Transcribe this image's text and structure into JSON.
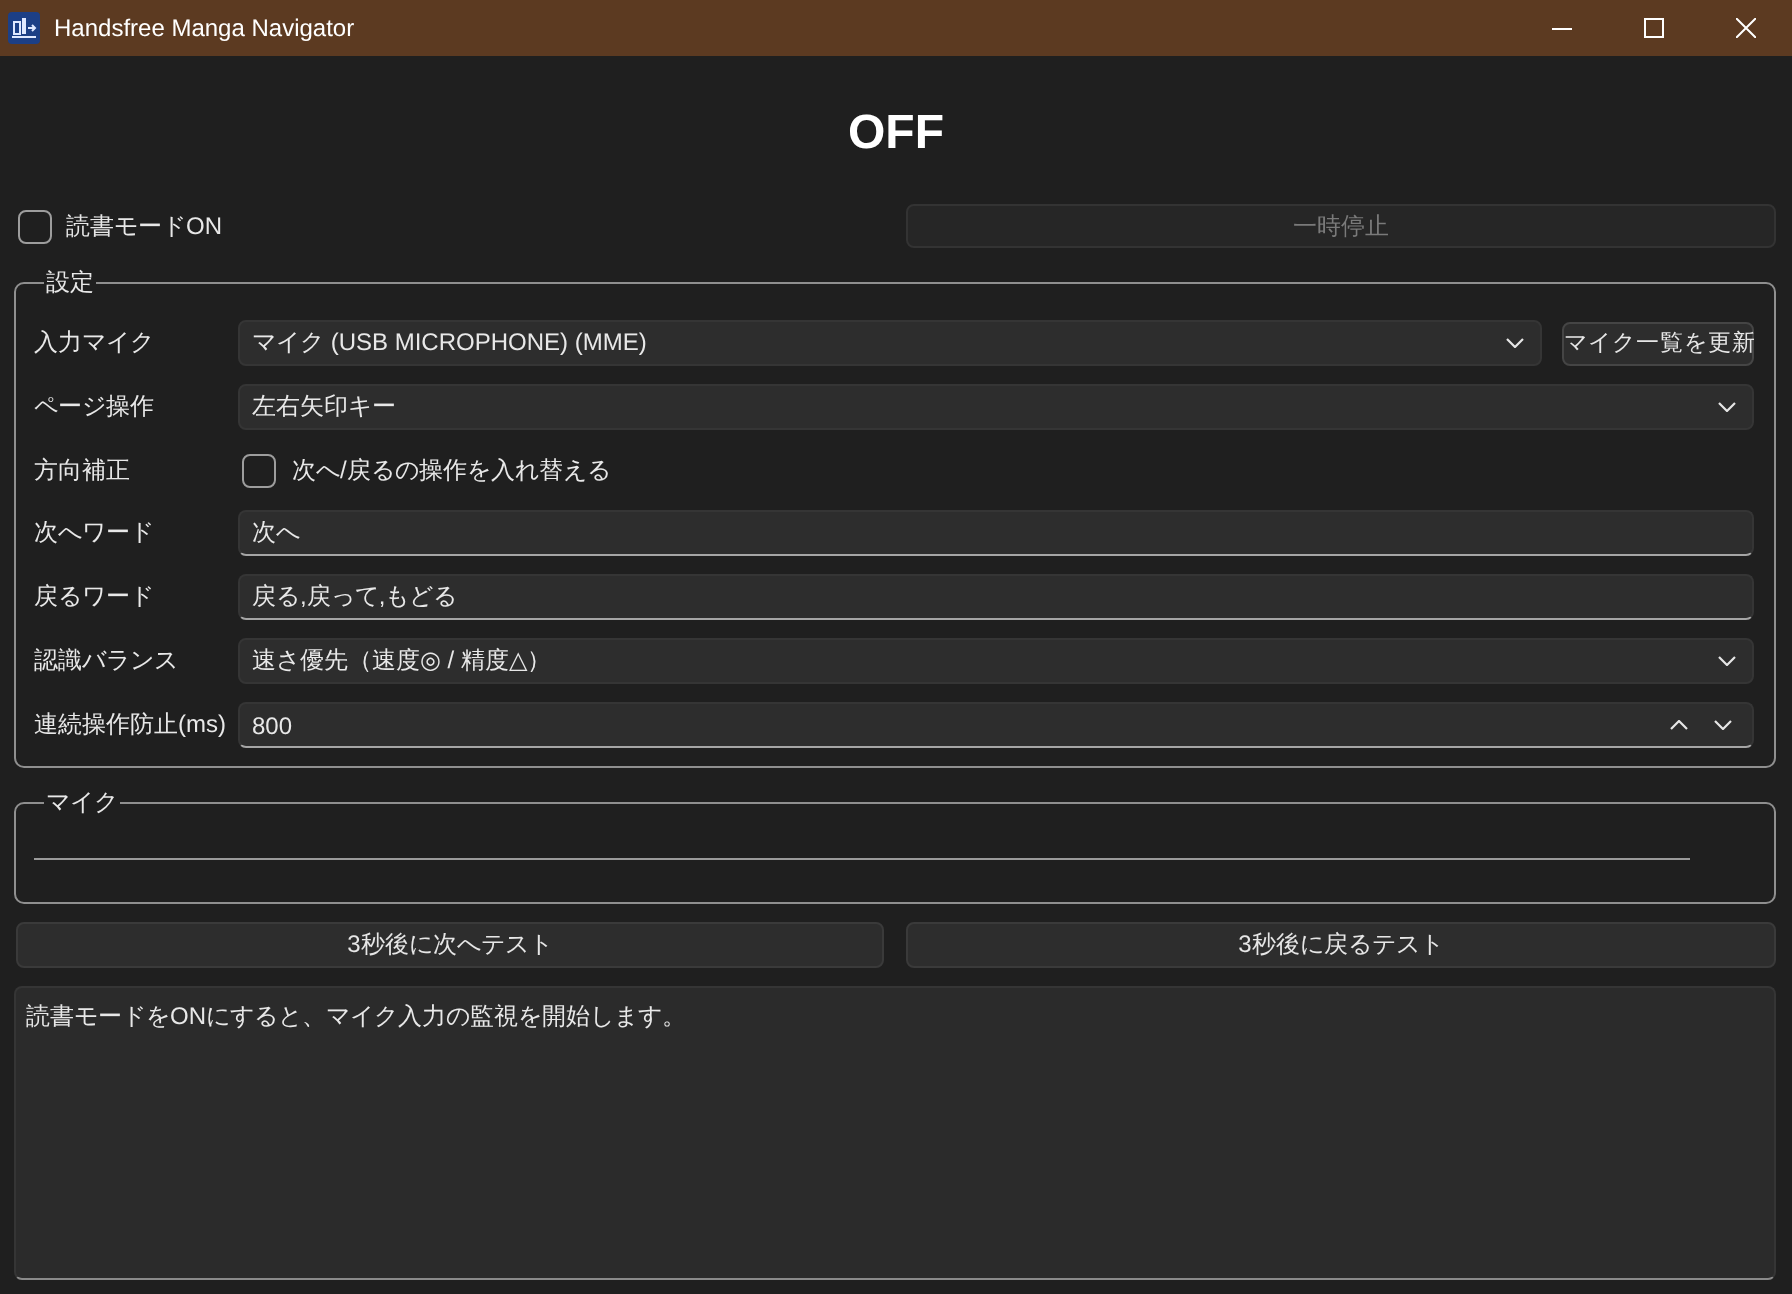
{
  "window": {
    "title": "Handsfree Manga Navigator"
  },
  "status": {
    "text": "OFF"
  },
  "reading_mode": {
    "label": "読書モードON",
    "checked": false
  },
  "pause_button": {
    "label": "一時停止",
    "disabled": true
  },
  "settings": {
    "title": "設定",
    "rows": [
      {
        "kind": "combo",
        "label": "入力マイク",
        "value": "マイク (USB MICROPHONE) (MME)",
        "button": "マイク一覧を更新"
      },
      {
        "kind": "combo",
        "label": "ページ操作",
        "value": "左右矢印キー"
      },
      {
        "kind": "checkbox",
        "label": "方向補正",
        "text": "次へ/戻るの操作を入れ替える",
        "checked": false
      },
      {
        "kind": "text",
        "label": "次へワード",
        "value": "次へ"
      },
      {
        "kind": "text",
        "label": "戻るワード",
        "value": "戻る,戻って,もどる"
      },
      {
        "kind": "combo",
        "label": "認識バランス",
        "value": "速さ優先（速度◎ / 精度△）"
      },
      {
        "kind": "spin",
        "label": "連続操作防止(ms)",
        "value": "800"
      }
    ]
  },
  "mic": {
    "title": "マイク",
    "level": 0
  },
  "test_buttons": [
    {
      "label": "3秒後に次へテスト"
    },
    {
      "label": "3秒後に戻るテスト"
    }
  ],
  "log": {
    "text": "読書モードをONにすると、マイク入力の監視を開始します。"
  }
}
